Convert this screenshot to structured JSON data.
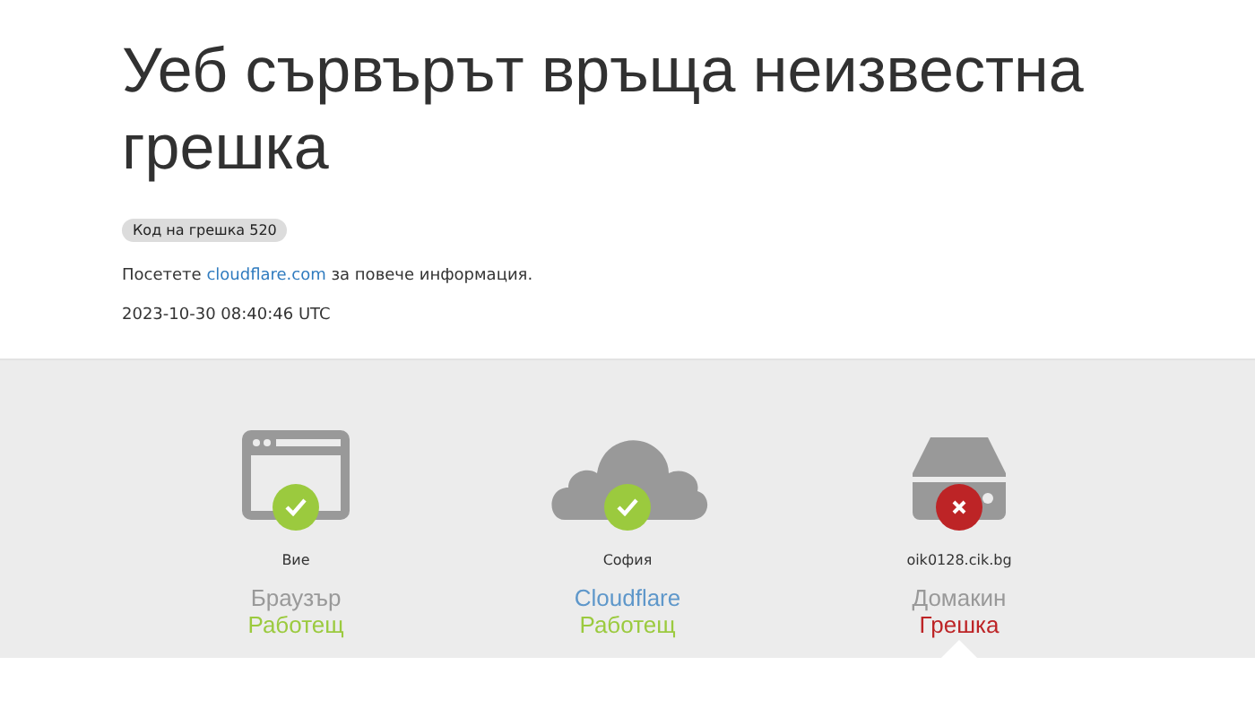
{
  "title": "Уеб сървърът връща неизвестна грешка",
  "error_code": "Код на грешка 520",
  "visit": {
    "prefix": "Посетете",
    "link": "cloudflare.com",
    "suffix": "за повече информация."
  },
  "timestamp": "2023-10-30 08:40:46 UTC",
  "nodes": [
    {
      "kind": "browser",
      "location": "Вие",
      "name": "Браузър",
      "name_is_link": false,
      "status": "Работещ",
      "ok": true,
      "selected": false
    },
    {
      "kind": "cloud",
      "location": "София",
      "name": "Cloudflare",
      "name_is_link": true,
      "status": "Работещ",
      "ok": true,
      "selected": false
    },
    {
      "kind": "server",
      "location": "oik0128.cik.bg",
      "name": "Домакин",
      "name_is_link": false,
      "status": "Грешка",
      "ok": false,
      "selected": true
    }
  ]
}
